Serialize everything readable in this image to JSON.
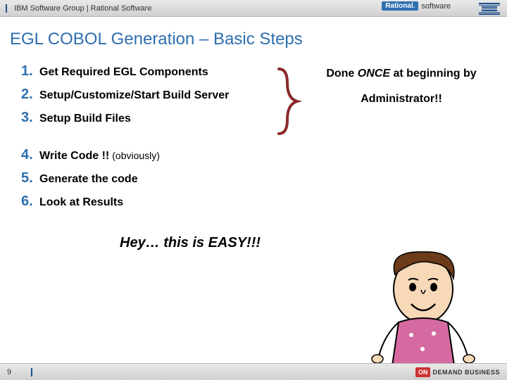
{
  "header": {
    "breadcrumb": "IBM Software Group | Rational Software",
    "badge_brand": "Rational.",
    "badge_suffix": "software"
  },
  "title": "EGL COBOL Generation – Basic Steps",
  "steps": [
    {
      "text": "Get Required EGL Components"
    },
    {
      "text": "Setup/Customize/Start Build Server"
    },
    {
      "text": "Setup Build Files"
    },
    {
      "text": "Write Code !!",
      "aside": "(obviously)"
    },
    {
      "text": "Generate the code"
    },
    {
      "text": "Look at Results"
    }
  ],
  "annotation": {
    "line1_pre": "Done ",
    "line1_emph": "ONCE",
    "line1_post": " at beginning by",
    "line2": "Administrator!!"
  },
  "callout": "Hey… this is EASY!!!",
  "footer": {
    "page": "9",
    "on": "ON",
    "demand": "DEMAND BUSINESS"
  },
  "colors": {
    "accent": "#2e6fb0",
    "brace": "#8a2a2a"
  }
}
